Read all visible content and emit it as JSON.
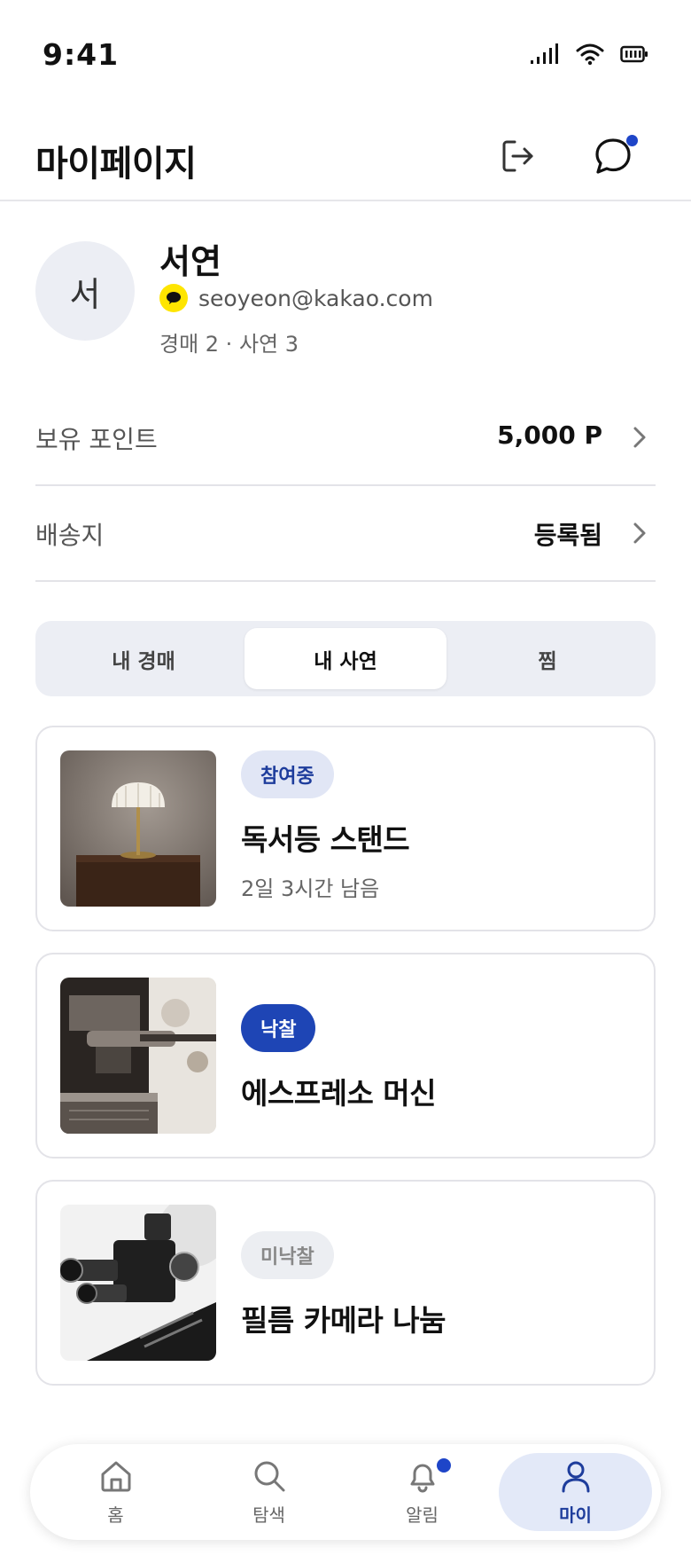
{
  "status_bar": {
    "time": "9:41"
  },
  "header": {
    "title": "마이페이지"
  },
  "profile": {
    "avatar_initial": "서",
    "name": "서연",
    "email": "seoyeon@kakao.com",
    "stats": "경매 2 · 사연 3"
  },
  "info_rows": [
    {
      "label": "보유 포인트",
      "value": "5,000 P"
    },
    {
      "label": "배송지",
      "value": "등록됨"
    }
  ],
  "tabs": [
    {
      "label": "내 경매"
    },
    {
      "label": "내 사연",
      "active": true
    },
    {
      "label": "찜"
    }
  ],
  "items": [
    {
      "status": "참여중",
      "title": "독서등 스탠드",
      "subtitle": "2일 3시간 남음"
    },
    {
      "status": "낙찰",
      "title": "에스프레소 머신"
    },
    {
      "status": "미낙찰",
      "title": "필름 카메라 나눔"
    }
  ],
  "bottom_nav": [
    {
      "label": "홈",
      "icon": "home-icon"
    },
    {
      "label": "탐색",
      "icon": "search-icon"
    },
    {
      "label": "알림",
      "icon": "bell-icon"
    },
    {
      "label": "마이",
      "icon": "user-icon",
      "active": true
    }
  ],
  "colors": {
    "accent": "#1e45b5",
    "kakao": "#fee500",
    "tab_bg": "#eceef4"
  }
}
